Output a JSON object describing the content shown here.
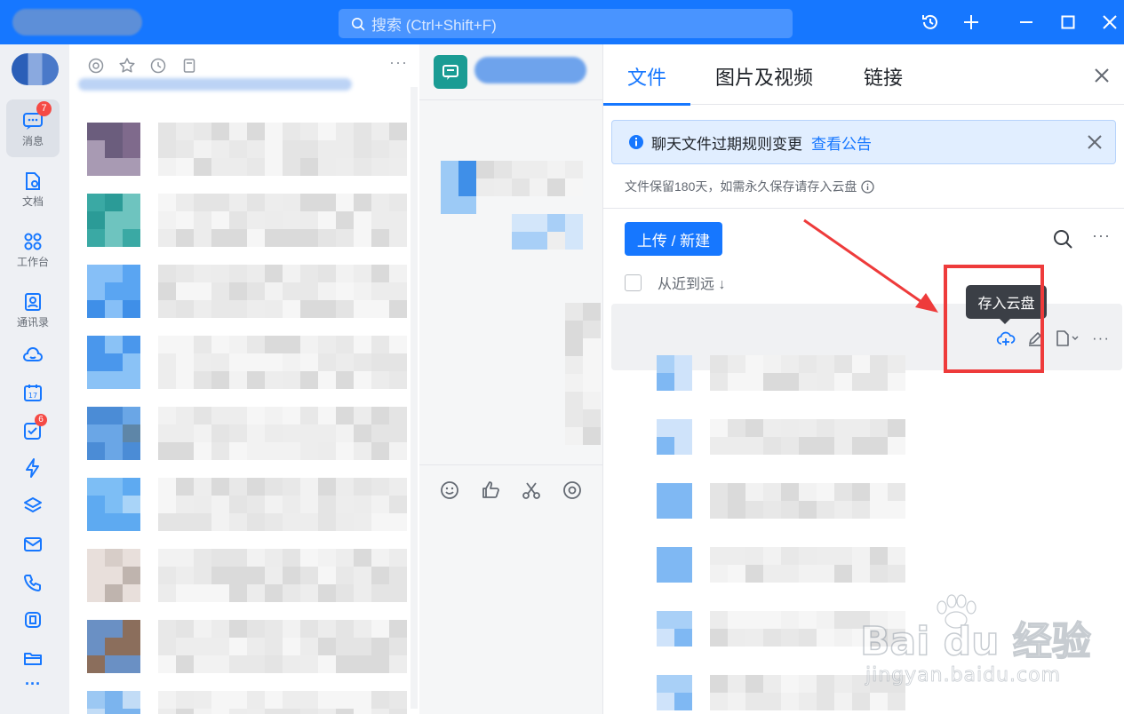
{
  "titlebar": {
    "search_placeholder": "搜索 (Ctrl+Shift+F)"
  },
  "nav": {
    "items": [
      {
        "label": "消息",
        "icon": "message-icon",
        "badge": "7"
      },
      {
        "label": "文档",
        "icon": "document-icon"
      },
      {
        "label": "工作台",
        "icon": "workbench-icon"
      },
      {
        "label": "通讯录",
        "icon": "contacts-icon"
      },
      {
        "label": "",
        "icon": "cloud-icon"
      },
      {
        "label": "",
        "icon": "calendar-icon",
        "text": "17"
      },
      {
        "label": "",
        "icon": "todo-icon",
        "badge": "6"
      },
      {
        "label": "",
        "icon": "lightning-icon"
      },
      {
        "label": "",
        "icon": "layers-icon"
      },
      {
        "label": "",
        "icon": "mail-icon"
      },
      {
        "label": "",
        "icon": "phone-icon"
      },
      {
        "label": "",
        "icon": "meeting-icon"
      },
      {
        "label": "",
        "icon": "folder-icon"
      },
      {
        "label": "···",
        "icon": "more-icon"
      }
    ]
  },
  "convlist": {
    "more": "···"
  },
  "filepanel": {
    "tabs": [
      "文件",
      "图片及视频",
      "链接"
    ],
    "active_tab": 0,
    "notice": {
      "text": "聊天文件过期规则变更",
      "link": "查看公告"
    },
    "retention": "文件保留180天，如需永久保存请存入云盘",
    "upload_label": "上传 / 新建",
    "more": "···",
    "sort_label": "从近到远 ↓",
    "tooltip": "存入云盘",
    "row_more": "···"
  },
  "watermark": {
    "main": "Bai du 经验",
    "sub": "jingyan.baidu.com"
  },
  "colors": {
    "accent": "#1677ff",
    "annotation": "#ee3b3b",
    "notice_bg": "#e1eeff"
  }
}
